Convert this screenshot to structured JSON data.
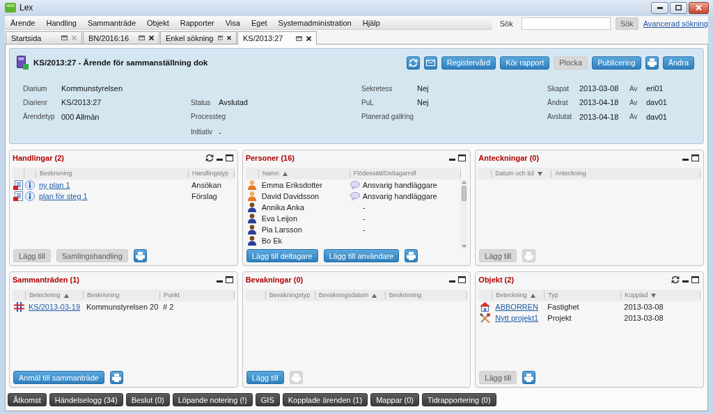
{
  "window": {
    "title": "Lex"
  },
  "menu": [
    "Ärende",
    "Handling",
    "Sammanträde",
    "Objekt",
    "Rapporter",
    "Visa",
    "Eget",
    "Systemadministration",
    "Hjälp"
  ],
  "search": {
    "label": "Sök",
    "button": {
      "label": "Sök",
      "disabled": true
    },
    "link": "Avancerad sökning"
  },
  "tabs": [
    {
      "label": "Startsida",
      "selected": false,
      "closable": false
    },
    {
      "label": "BN/2016:16",
      "selected": false,
      "closable": true
    },
    {
      "label": "Enkel sökning",
      "selected": false,
      "closable": true
    },
    {
      "label": "KS/2013:27",
      "selected": true,
      "closable": true
    }
  ],
  "case": {
    "title": "KS/2013:27 - Ärende för sammanställning dok",
    "buttons": [
      {
        "kind": "refresh",
        "disabled": false
      },
      {
        "kind": "mail",
        "disabled": false
      },
      {
        "kind": "text",
        "label": "Registervård",
        "disabled": false
      },
      {
        "kind": "text",
        "label": "Kör rapport",
        "disabled": false
      },
      {
        "kind": "text",
        "label": "Plocka",
        "disabled": true
      },
      {
        "kind": "text",
        "label": "Publicering",
        "disabled": false
      },
      {
        "kind": "print",
        "disabled": false
      },
      {
        "kind": "text",
        "label": "Ändra",
        "disabled": false
      }
    ],
    "details": [
      {
        "fields": [
          {
            "label": "Diarium",
            "value": "Kommunstyrelsen"
          },
          {
            "label": "Diarienr",
            "value": "KS/2013:27"
          },
          {
            "label": "Ärendetyp",
            "value": "000 Allmän"
          }
        ]
      },
      {
        "fields": [
          {
            "label": "Status",
            "value": "Avslutad"
          },
          {
            "label": "Processteg"
          },
          {
            "label": "Initiativ",
            "value": "-"
          }
        ]
      },
      {
        "fields": [
          {
            "label": "Sekretess",
            "value": "Nej"
          },
          {
            "label": "PuL",
            "value": "Nej"
          },
          {
            "label": "Planerad gallring"
          }
        ]
      },
      {
        "fields": [
          {
            "label": "Skapat",
            "value": "2013-03-08",
            "by_label": "Av",
            "by": "eri01"
          },
          {
            "label": "Ändrat",
            "value": "2013-04-18",
            "by_label": "Av",
            "by": "dav01"
          },
          {
            "label": "Avslutat",
            "value": "2013-04-18",
            "by_label": "Av",
            "by": "dav01"
          }
        ]
      }
    ]
  },
  "panels": [
    {
      "kind": "documents",
      "title": "Handlingar (2)",
      "refresh": true,
      "scrollbar": false,
      "columns": [
        {
          "label": "Beskrivning",
          "ascending": false,
          "descending": false
        },
        {
          "label": "Handlingstyp",
          "ascending": false,
          "descending": false
        }
      ],
      "rows": [
        {
          "kind": "document",
          "cells": [
            "ny plan 1",
            "Ansökan"
          ]
        },
        {
          "kind": "document",
          "cells": [
            "plan för steg 1",
            "Förslag"
          ]
        }
      ],
      "buttons": [
        {
          "kind": "text",
          "label": "Lägg till",
          "disabled": true
        },
        {
          "kind": "text",
          "label": "Samlingshandling",
          "disabled": true
        },
        {
          "kind": "print",
          "disabled": false
        }
      ]
    },
    {
      "kind": "persons",
      "title": "Personer (16)",
      "refresh": false,
      "scrollbar": true,
      "columns": [
        {
          "label": "Namn",
          "ascending": true,
          "descending": false
        },
        {
          "label": "Flödessätt/Deltagarroll",
          "ascending": false,
          "descending": false
        }
      ],
      "rows": [
        {
          "kind": "handler",
          "cells": [
            "Emma Eriksdotter",
            "Ansvarig handläggare"
          ]
        },
        {
          "kind": "handler",
          "cells": [
            "David Davidsson",
            "Ansvarig handläggare"
          ]
        },
        {
          "kind": "participant",
          "cells": [
            "Annika Anka",
            "-"
          ]
        },
        {
          "kind": "participant",
          "cells": [
            "Eva Leijon",
            "-"
          ]
        },
        {
          "kind": "participant",
          "cells": [
            "Pia Larsson",
            "-"
          ]
        },
        {
          "kind": "participant",
          "cells": [
            "Bo Ek"
          ]
        }
      ],
      "buttons": [
        {
          "kind": "text",
          "label": "Lägg till deltagare",
          "disabled": false
        },
        {
          "kind": "text",
          "label": "Lägg till användare",
          "disabled": false
        },
        {
          "kind": "print",
          "disabled": false
        }
      ]
    },
    {
      "kind": "notes",
      "title": "Anteckningar (0)",
      "refresh": false,
      "scrollbar": false,
      "columns": [
        {
          "label": "Datum och tid",
          "ascending": false,
          "descending": true
        },
        {
          "label": "Anteckning",
          "ascending": false,
          "descending": false
        }
      ],
      "buttons": [
        {
          "kind": "text",
          "label": "Lägg till",
          "disabled": true
        },
        {
          "kind": "print",
          "disabled": true
        }
      ]
    },
    {
      "kind": "meetings",
      "title": "Sammanträden (1)",
      "refresh": false,
      "scrollbar": false,
      "columns": [
        {
          "label": "Beteckning",
          "ascending": true,
          "descending": false
        },
        {
          "label": "Beskrivning",
          "ascending": false,
          "descending": false
        },
        {
          "label": "Punkt",
          "ascending": false,
          "descending": false
        }
      ],
      "rows": [
        {
          "kind": "meeting",
          "cells": [
            "KS/2013-03-19",
            "Kommunstyrelsen 20",
            "# 2"
          ]
        }
      ],
      "buttons": [
        {
          "kind": "text",
          "label": "Anmäl till sammanträde",
          "disabled": false
        },
        {
          "kind": "print",
          "disabled": false
        }
      ]
    },
    {
      "kind": "watches",
      "title": "Bevakningar (0)",
      "refresh": false,
      "scrollbar": false,
      "columns": [
        {
          "label": "Bevakningstyp",
          "ascending": false,
          "descending": false
        },
        {
          "label": "Bevakningsdatum",
          "ascending": true,
          "descending": false
        },
        {
          "label": "Beskrivning",
          "ascending": false,
          "descending": false
        }
      ],
      "buttons": [
        {
          "kind": "text",
          "label": "Lägg till",
          "disabled": false
        },
        {
          "kind": "print",
          "disabled": true
        }
      ]
    },
    {
      "kind": "objects",
      "title": "Objekt (2)",
      "refresh": true,
      "scrollbar": false,
      "columns": [
        {
          "label": "Beteckning",
          "ascending": true,
          "descending": false
        },
        {
          "label": "Typ",
          "ascending": false,
          "descending": false
        },
        {
          "label": "Kopplad",
          "ascending": false,
          "descending": true
        }
      ],
      "rows": [
        {
          "kind": "property",
          "cells": [
            "ABBORREN",
            "Fastighet",
            "2013-03-08"
          ]
        },
        {
          "kind": "project",
          "cells": [
            "Nytt projekt1",
            "Projekt",
            "2013-03-08"
          ]
        }
      ],
      "buttons": [
        {
          "kind": "text",
          "label": "Lägg till",
          "disabled": true
        },
        {
          "kind": "print",
          "disabled": false
        }
      ]
    }
  ],
  "bottom_buttons": [
    "Åtkomst",
    "Händelselogg (34)",
    "Beslut (0)",
    "Löpande notering (!)",
    "GIS",
    "Kopplade ärenden (1)",
    "Mappar (0)",
    "Tidrapportering (0)"
  ]
}
